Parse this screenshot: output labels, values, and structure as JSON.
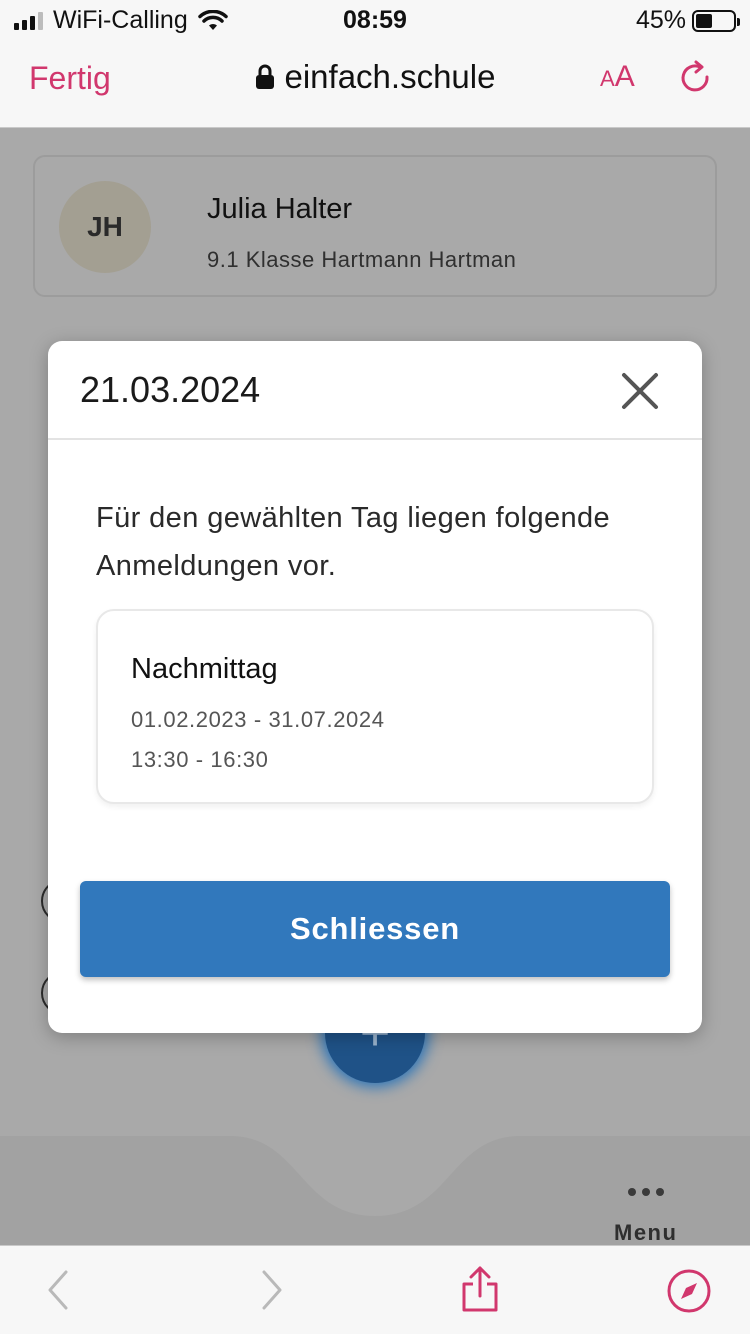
{
  "status_bar": {
    "carrier": "WiFi-Calling",
    "time": "08:59",
    "battery": "45%",
    "battery_level": 0.45
  },
  "safari_top": {
    "done_label": "Fertig",
    "domain": "einfach.schule",
    "text_size_label_small": "A",
    "text_size_label_large": "A"
  },
  "profile": {
    "initials": "JH",
    "name": "Julia Halter",
    "class": "9.1 Klasse Hartmann Hartman"
  },
  "modal": {
    "title": "21.03.2024",
    "intro": "Für den gewählten Tag liegen folgende Anmeldungen vor.",
    "registration": {
      "title": "Nachmittag",
      "date_range": "01.02.2023 - 31.07.2024",
      "time_range": "13:30 - 16:30"
    },
    "close_label": "Schliessen"
  },
  "bottom_nav": {
    "fab_symbol": "+",
    "menu_label": "Menu"
  },
  "colors": {
    "accent_pink": "#d1376d",
    "primary_blue": "#3178bc",
    "overlay_gray": "#a9a9a9"
  }
}
